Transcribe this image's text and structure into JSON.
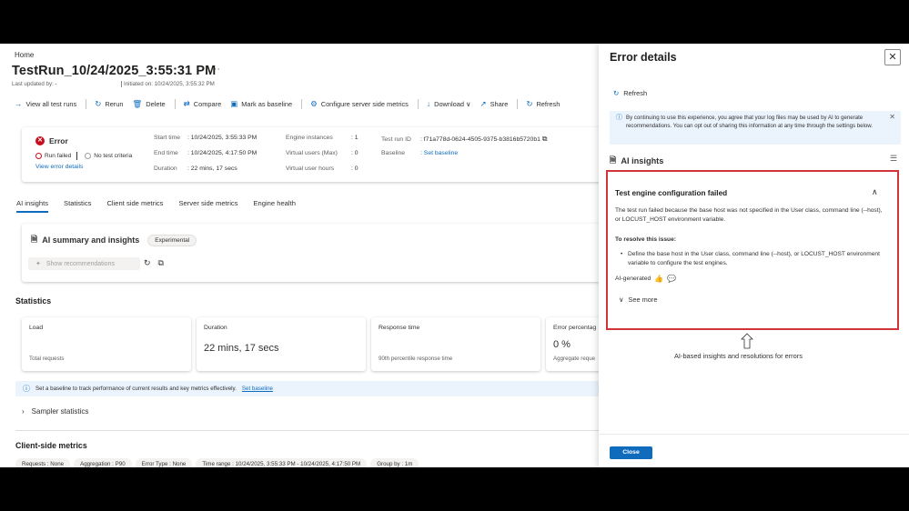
{
  "main": {
    "breadcrumb": "Home",
    "title": "TestRun_10/24/2025_3:55:31 PM",
    "title_more": "···",
    "last_updated": "Last updated by: -",
    "initiated": "Initiated on: 10/24/2025, 3:55:32 PM",
    "toolbar": [
      {
        "icon": "→",
        "label": "View all test runs"
      },
      {
        "icon": "↻",
        "label": "Rerun"
      },
      {
        "icon": "🗑",
        "label": "Delete"
      },
      {
        "icon": "⇄",
        "label": "Compare"
      },
      {
        "icon": "▣",
        "label": "Mark as baseline"
      },
      {
        "icon": "⚙",
        "label": "Configure server side metrics"
      },
      {
        "icon": "↓",
        "label": "Download ∨"
      },
      {
        "icon": "↗",
        "label": "Share"
      },
      {
        "icon": "↻",
        "label": "Refresh"
      }
    ],
    "summary": {
      "status": "Error",
      "run_failed": "Run failed",
      "no_test_criteria": "No test criteria",
      "view_error": "View error details",
      "start_time_k": "Start time",
      "start_time_v": ": 10/24/2025, 3:55:33 PM",
      "end_time_k": "End time",
      "end_time_v": ": 10/24/2025, 4:17:50 PM",
      "duration_k": "Duration",
      "duration_v": ": 22 mins, 17 secs",
      "engine_k": "Engine instances",
      "engine_v": ": 1",
      "vusers_max_k": "Virtual users (Max)",
      "vusers_max_v": ": 0",
      "vuser_hours_k": "Virtual user hours",
      "vuser_hours_v": ": 0",
      "run_id_k": "Test run ID",
      "run_id_v": ": f71a778d-0624-4505-9375-b3816b5720b1",
      "baseline_k": "Baseline",
      "baseline_v": "Set baseline"
    },
    "tabs": [
      "AI insights",
      "Statistics",
      "Client side metrics",
      "Server side metrics",
      "Engine health"
    ],
    "ai_card": {
      "title": "AI summary and insights",
      "pill": "Experimental",
      "show_rec": "Show recommendations"
    },
    "statistics_title": "Statistics",
    "stats": [
      {
        "label": "Load",
        "value": "",
        "sub": "Total requests"
      },
      {
        "label": "Duration",
        "value": "22 mins, 17 secs",
        "sub": ""
      },
      {
        "label": "Response time",
        "value": "",
        "sub": "90th percentile response time"
      },
      {
        "label": "Error percentag",
        "value": "0 %",
        "sub": "Aggregate reque"
      }
    ],
    "baseline_msg": "Set a baseline to track performance of current results and key metrics effectively.",
    "baseline_link": "Set baseline",
    "sampler": "Sampler statistics",
    "client_metrics_title": "Client-side metrics",
    "chips": [
      "Requests : None",
      "Aggregation : P90",
      "Error Type : None",
      "Time range : 10/24/2025, 3:55:33 PM - 10/24/2025, 4:17:50 PM",
      "Group by : 1m"
    ]
  },
  "panel": {
    "title": "Error details",
    "refresh": "Refresh",
    "notice": "By continuing to use this experience, you agree that your log files may be used by AI to generate recommendations. You can opt out of sharing this information at any time through the settings below.",
    "ai_insights": "AI insights",
    "error_heading": "Test engine configuration failed",
    "error_desc": "The test run failed because the base host was not specified in the User class, command line (--host), or LOCUST_HOST environment variable.",
    "resolve_heading": "To resolve this issue:",
    "resolve_bullet": "Define the base host in the User class, command line (--host), or LOCUST_HOST environment variable to configure the test engines.",
    "ai_generated": "AI-generated",
    "see_more": "See more",
    "close": "Close"
  },
  "annotation": "AI-based insights and resolutions for errors",
  "colors": {
    "accent": "#0f6cbd",
    "error": "#c50f1f",
    "highlight": "#d13438"
  }
}
